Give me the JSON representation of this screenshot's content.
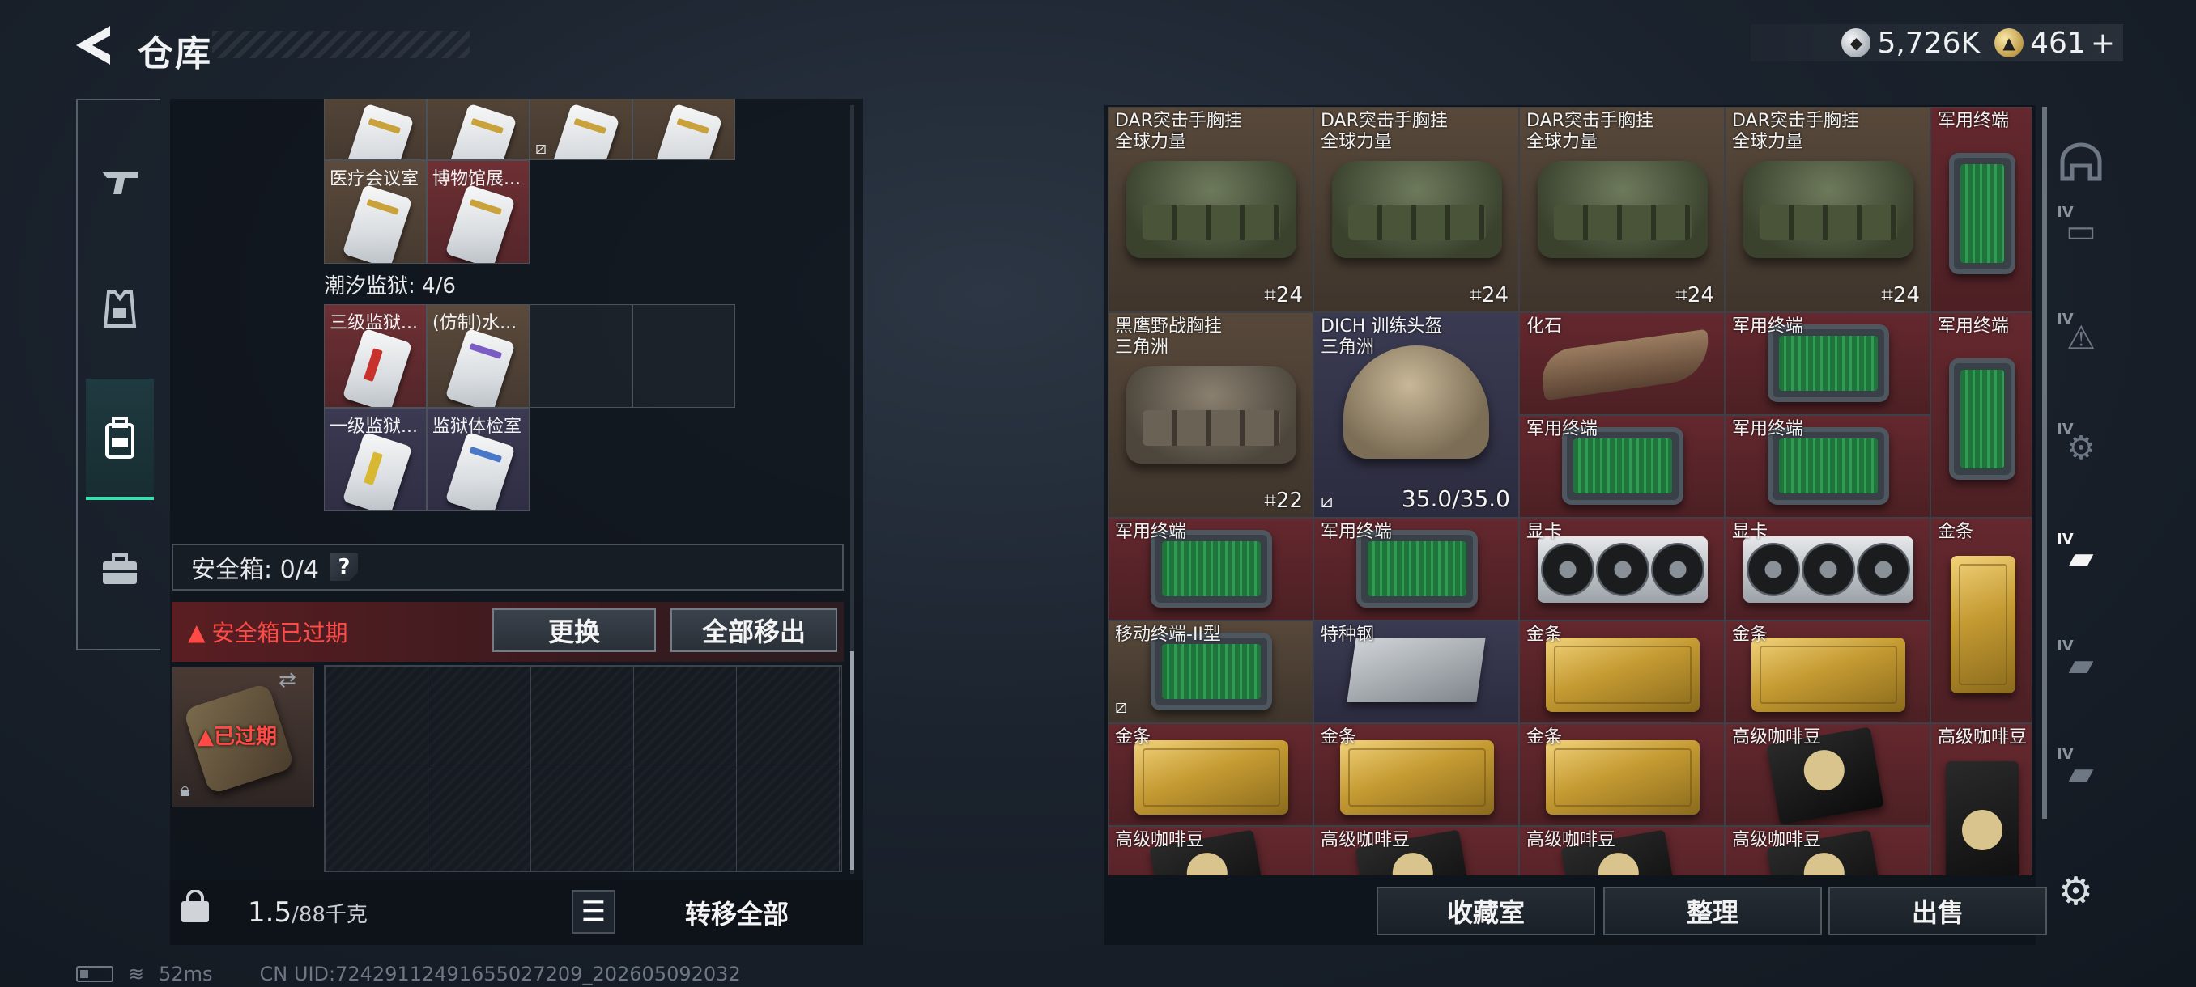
{
  "header": {
    "title": "仓库",
    "currency_silver": "5,726K",
    "currency_gold": "461",
    "currency_plus": "+"
  },
  "left_nav": [
    {
      "name": "weapon",
      "icon": "gun-icon"
    },
    {
      "name": "gear",
      "icon": "vest-icon"
    },
    {
      "name": "backpack",
      "icon": "backpack-icon",
      "active": true
    },
    {
      "name": "case",
      "icon": "briefcase-icon"
    }
  ],
  "keycards": {
    "medical_label": "医疗会议室",
    "museum_label": "博物馆展...",
    "prison_section": "潮汐监狱: 4/6",
    "level3_label": "三级监狱...",
    "replica_label": "(仿制)水...",
    "level1_label": "一级监狱...",
    "checkup_label": "监狱体检室"
  },
  "safe_box": {
    "label": "安全箱: 0/4",
    "help": "?",
    "expired_warning": "安全箱已过期",
    "replace_button": "更换",
    "move_all_button": "全部移出",
    "expired_tag": "已过期"
  },
  "bottom_left": {
    "weight_value": "1.5",
    "weight_unit": "/88千克",
    "transfer_all": "转移全部"
  },
  "status": {
    "ping": "52ms",
    "uid": "CN UID:7242911249165502720​9_202605092032"
  },
  "items": {
    "dar_name": "DAR突击手胸挂",
    "dar_sub": "全球力量",
    "dar_cap": "24",
    "blackhawk_name": "黑鹰野战胸挂",
    "blackhawk_sub": "三角洲",
    "blackhawk_cap": "22",
    "helmet_name": "DICH 训练头盔",
    "helmet_sub": "三角洲",
    "helmet_dur": "35.0/35.0",
    "fossil": "化石",
    "terminal": "军用终端",
    "gpu": "显卡",
    "gold": "金条",
    "mobile_terminal": "移动终端-II型",
    "steel": "特种钢",
    "coffee": "高级咖啡豆"
  },
  "right_nav": [
    {
      "level": "",
      "icon": "helmet-icon"
    },
    {
      "level": "IV",
      "icon": "camera-rack-icon"
    },
    {
      "level": "IV",
      "icon": "warning-rack-icon"
    },
    {
      "level": "IV",
      "icon": "gear-rack-icon"
    },
    {
      "level": "IV",
      "icon": "truck-icon",
      "active": true
    },
    {
      "level": "IV",
      "icon": "truck-icon"
    },
    {
      "level": "IV",
      "icon": "truck-icon"
    }
  ],
  "actions": {
    "collection": "收藏室",
    "organize": "整理",
    "sell": "出售"
  }
}
